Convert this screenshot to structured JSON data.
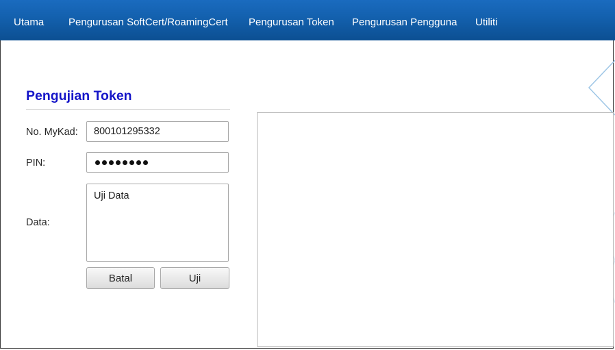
{
  "menu": {
    "items": [
      {
        "label": "Utama"
      },
      {
        "label": "Pengurusan SoftCert/RoamingCert"
      },
      {
        "label": "Pengurusan Token"
      },
      {
        "label": "Pengurusan Pengguna"
      },
      {
        "label": "Utiliti"
      }
    ]
  },
  "form": {
    "title": "Pengujian Token",
    "mykad_label": "No. MyKad:",
    "mykad_value": "800101295332",
    "pin_label": "PIN:",
    "pin_mask_length": 8,
    "data_label": "Data:",
    "data_value": "Uji Data",
    "cancel_label": "Batal",
    "test_label": "Uji"
  },
  "output": {
    "text": ""
  },
  "colors": {
    "topbar": "#1360ad",
    "title": "#1515c8",
    "decor": "#9ec6e6"
  }
}
